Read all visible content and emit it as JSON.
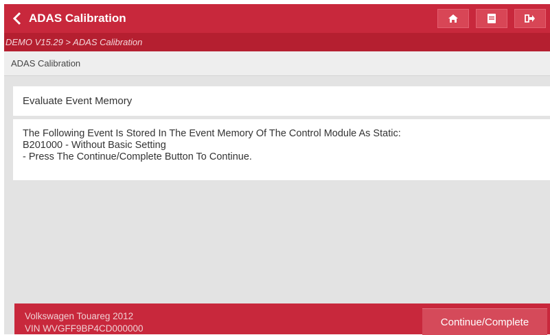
{
  "header": {
    "title": "ADAS Calibration",
    "buttons": [
      {
        "icon": "home-icon"
      },
      {
        "icon": "print-icon"
      },
      {
        "icon": "exit-icon"
      }
    ]
  },
  "breadcrumb": "DEMO V15.29 > ADAS Calibration",
  "section_title": "ADAS Calibration",
  "main": {
    "card_title": "Evaluate Event Memory",
    "message_lines": [
      "The Following Event Is Stored In The Event Memory Of The Control Module As Static:",
      "B201000 - Without Basic Setting",
      "- Press The Continue/Complete Button To Continue."
    ]
  },
  "footer": {
    "vehicle": "Volkswagen Touareg 2012",
    "vin": "VIN WVGFF9BP4CD000000",
    "continue_label": "Continue/Complete"
  },
  "colors": {
    "accent": "#c8283c",
    "breadcrumb_bg": "#b51f30",
    "background": "#e3e3e3"
  }
}
